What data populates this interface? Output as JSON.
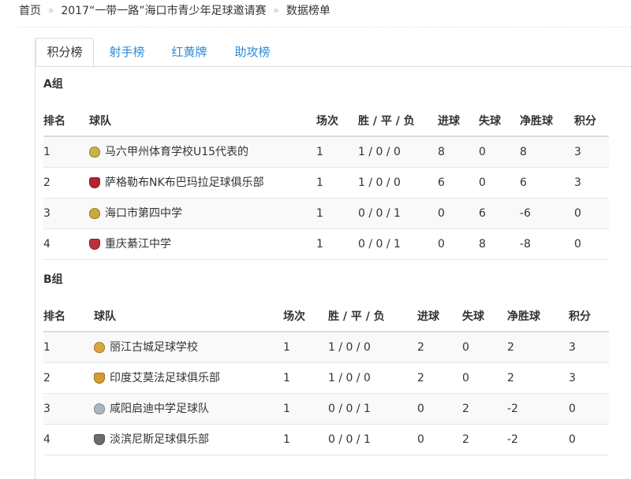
{
  "breadcrumb": {
    "home": "首页",
    "event": "2017“一带一路”海口市青少年足球邀请赛",
    "current": "数据榜单",
    "separator": "»"
  },
  "tabs": [
    "积分榜",
    "射手榜",
    "红黄牌",
    "助攻榜"
  ],
  "active_tab": 0,
  "columns": [
    "排名",
    "球队",
    "场次",
    "胜 / 平 / 负",
    "进球",
    "失球",
    "净胜球",
    "积分"
  ],
  "groups": [
    {
      "title": "A组",
      "rows": [
        {
          "rank": "1",
          "team": "马六甲州体育学校U15代表的",
          "played": "1",
          "wdl": "1 / 0 / 0",
          "gf": "8",
          "ga": "0",
          "gd": "8",
          "pts": "3",
          "badge_icon": "team-crest-icon",
          "badge_color": "#c9b24a"
        },
        {
          "rank": "2",
          "team": "萨格勒布NK布巴玛拉足球俱乐部",
          "played": "1",
          "wdl": "1 / 0 / 0",
          "gf": "6",
          "ga": "0",
          "gd": "6",
          "pts": "3",
          "badge_icon": "team-crest-icon",
          "badge_color": "#b3242f"
        },
        {
          "rank": "3",
          "team": "海口市第四中学",
          "played": "1",
          "wdl": "0 / 0 / 1",
          "gf": "0",
          "ga": "6",
          "gd": "-6",
          "pts": "0",
          "badge_icon": "team-crest-icon",
          "badge_color": "#c8a93a"
        },
        {
          "rank": "4",
          "team": "重庆綦江中学",
          "played": "1",
          "wdl": "0 / 0 / 1",
          "gf": "0",
          "ga": "8",
          "gd": "-8",
          "pts": "0",
          "badge_icon": "team-crest-icon",
          "badge_color": "#b8323a"
        }
      ]
    },
    {
      "title": "B组",
      "rows": [
        {
          "rank": "1",
          "team": "丽江古城足球学校",
          "played": "1",
          "wdl": "1 / 0 / 0",
          "gf": "2",
          "ga": "0",
          "gd": "2",
          "pts": "3",
          "badge_icon": "team-crest-icon",
          "badge_color": "#d9a640"
        },
        {
          "rank": "2",
          "team": "印度艾莫法足球俱乐部",
          "played": "1",
          "wdl": "1 / 0 / 0",
          "gf": "2",
          "ga": "0",
          "gd": "2",
          "pts": "3",
          "badge_icon": "team-crest-icon",
          "badge_color": "#d49b2e"
        },
        {
          "rank": "3",
          "team": "咸阳启迪中学足球队",
          "played": "1",
          "wdl": "0 / 0 / 1",
          "gf": "0",
          "ga": "2",
          "gd": "-2",
          "pts": "0",
          "badge_icon": "team-crest-icon",
          "badge_color": "#a9b6c4"
        },
        {
          "rank": "4",
          "team": "淡滨尼斯足球俱乐部",
          "played": "1",
          "wdl": "0 / 0 / 1",
          "gf": "0",
          "ga": "2",
          "gd": "-2",
          "pts": "0",
          "badge_icon": "team-crest-icon",
          "badge_color": "#6b6b6b"
        }
      ]
    }
  ],
  "colors": {
    "link": "#2e8bd6",
    "text": "#333333",
    "stripe": "#f9f9f9"
  }
}
